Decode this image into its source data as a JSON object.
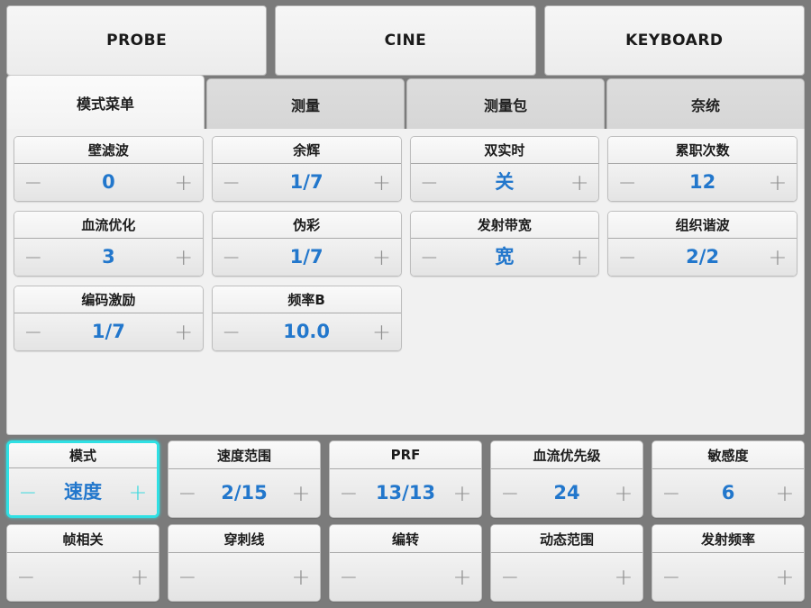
{
  "topbar": {
    "buttons": [
      {
        "label": "PROBE",
        "name": "probe-button"
      },
      {
        "label": "CINE",
        "name": "cine-button"
      },
      {
        "label": "KEYBOARD",
        "name": "keyboard-button"
      }
    ]
  },
  "tabs": [
    {
      "label": "模式菜单",
      "active": true
    },
    {
      "label": "测量",
      "active": false
    },
    {
      "label": "测量包",
      "active": false
    },
    {
      "label": "奈统",
      "active": false
    }
  ],
  "icons": {
    "minus": "−",
    "plus": "+"
  },
  "colors": {
    "value_blue": "#2277cc",
    "highlight_cyan": "#2fe0e4",
    "window_grey": "#7b7b7b",
    "panel_bg": "#f1f1f1"
  },
  "panel_params": [
    {
      "label": "壁滤波",
      "value": "0"
    },
    {
      "label": "余辉",
      "value": "1/7"
    },
    {
      "label": "双实时",
      "value": "关"
    },
    {
      "label": "累职次数",
      "value": "12"
    },
    {
      "label": "血流优化",
      "value": "3"
    },
    {
      "label": "伪彩",
      "value": "1/7"
    },
    {
      "label": "发射带宽",
      "value": "宽"
    },
    {
      "label": "组织谐波",
      "value": "2/2"
    },
    {
      "label": "编码激励",
      "value": "1/7"
    },
    {
      "label": "频率B",
      "value": "10.0"
    }
  ],
  "bottom_rows": [
    [
      {
        "label": "模式",
        "value": "速度",
        "selected": true
      },
      {
        "label": "速度范围",
        "value": "2/15",
        "selected": false
      },
      {
        "label": "PRF",
        "value": "13/13",
        "selected": false
      },
      {
        "label": "血流优先级",
        "value": "24",
        "selected": false
      },
      {
        "label": "敏感度",
        "value": "6",
        "selected": false
      }
    ],
    [
      {
        "label": "帧相关",
        "value": "",
        "selected": false
      },
      {
        "label": "穿刺线",
        "value": "",
        "selected": false
      },
      {
        "label": "编转",
        "value": "",
        "selected": false
      },
      {
        "label": "动态范围",
        "value": "",
        "selected": false
      },
      {
        "label": "发射频率",
        "value": "",
        "selected": false
      }
    ]
  ]
}
